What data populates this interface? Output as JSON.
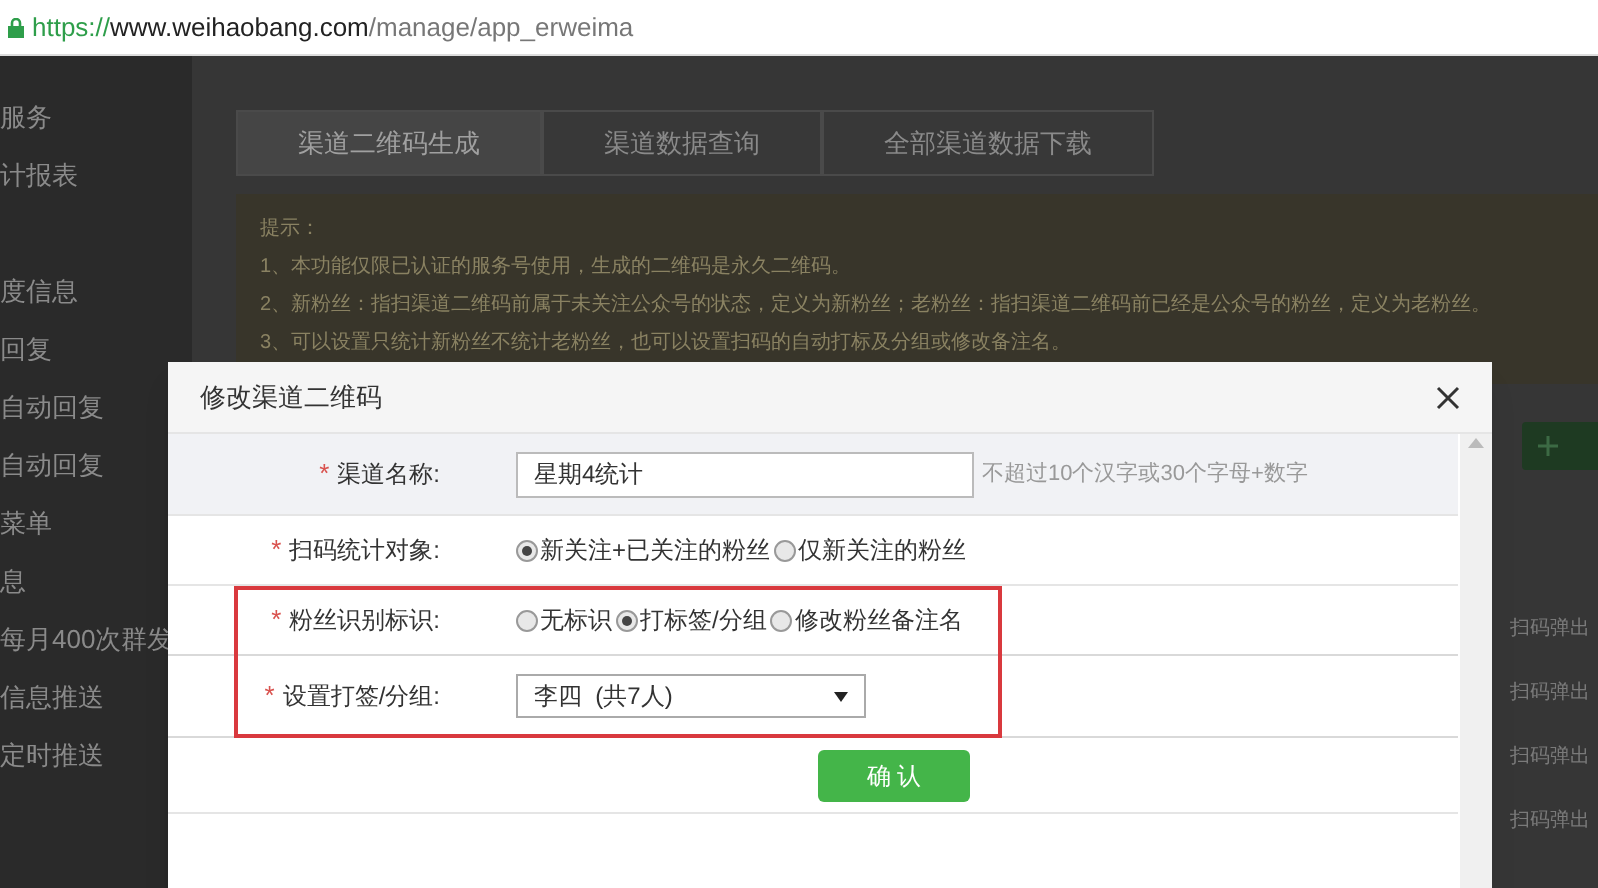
{
  "address_bar": {
    "scheme": "https://",
    "host": "www.weihaobang.com",
    "path": "/manage/app_erweima"
  },
  "sidebar": {
    "items": [
      "服务",
      "计报表",
      "度信息",
      "回复",
      "自动回复",
      "自动回复",
      "菜单",
      "息",
      "每月400次群发",
      "信息推送",
      "定时推送"
    ]
  },
  "tabs": [
    {
      "label": "渠道二维码生成",
      "selected": true
    },
    {
      "label": "渠道数据查询",
      "selected": false
    },
    {
      "label": "全部渠道数据下载",
      "selected": false
    }
  ],
  "notice": {
    "title": "提示：",
    "lines": [
      "1、本功能仅限已认证的服务号使用，生成的二维码是永久二维码。",
      "2、新粉丝：指扫渠道二维码前属于未关注公众号的状态，定义为新粉丝；老粉丝：指扫渠道二维码前已经是公众号的粉丝，定义为老粉丝。",
      "3、可以设置只统计新粉丝不统计老粉丝，也可以设置扫码的自动打标及分组或修改备注名。"
    ]
  },
  "background_rows": [
    "扫码弹出",
    "扫码弹出",
    "扫码弹出",
    "扫码弹出"
  ],
  "dialog": {
    "title": "修改渠道二维码",
    "fields": [
      {
        "kind": "text",
        "required_mark": "*",
        "label": "渠道名称:",
        "value": "星期4统计",
        "hint": "不超过10个汉字或30个字母+数字",
        "highlighted": false
      },
      {
        "kind": "radio",
        "required_mark": "*",
        "label": "扫码统计对象:",
        "options": [
          {
            "label": "新关注+已关注的粉丝",
            "selected": true
          },
          {
            "label": "仅新关注的粉丝",
            "selected": false
          }
        ],
        "highlighted": false
      },
      {
        "kind": "radio",
        "required_mark": "*",
        "label": "粉丝识别标识:",
        "options": [
          {
            "label": "无标识",
            "selected": false
          },
          {
            "label": "打标签/分组",
            "selected": true
          },
          {
            "label": "修改粉丝备注名",
            "selected": false
          }
        ],
        "highlighted": true
      },
      {
        "kind": "select",
        "required_mark": "*",
        "label": "设置打签/分组:",
        "value": "李四  (共7人)",
        "highlighted": true
      }
    ],
    "confirm_button": "确 认"
  }
}
